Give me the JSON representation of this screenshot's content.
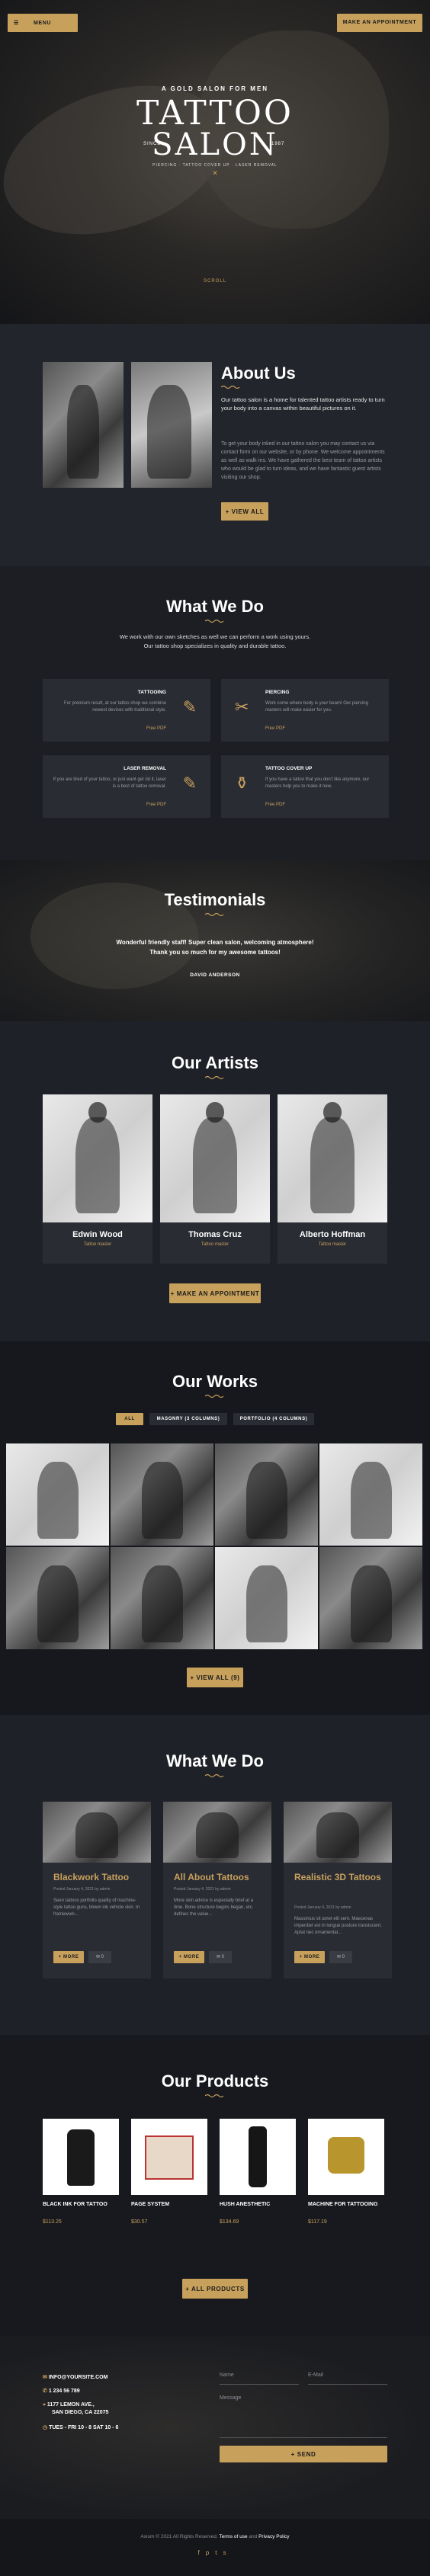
{
  "header": {
    "menu_label": "MENU",
    "appointment_label": "MAKE AN APPOINTMENT"
  },
  "hero": {
    "tagline": "A GOLD SALON FOR MEN",
    "title_line1": "TATTOO",
    "title_line2": "SALON",
    "since": "SINCE",
    "year": "1987",
    "sub": "PIERCING · TATTOO COVER UP · LASER REMOVAL",
    "scroll": "SCROLL"
  },
  "about": {
    "title": "About Us",
    "lead": "Our tattoo salon is a home for talented tattoo artists ready to turn your body into a canvas within beautiful pictures on it.",
    "body": "To get your body inked in our tattoo salon you may contact us via contact form on our website, or by phone. We welcome appointments as well as walk-ins. We have gathered the best team of tattoo artists who would be glad to turn ideas, and we have fantastic guest artists visiting our shop.",
    "button": "+ VIEW ALL"
  },
  "services": {
    "title": "What We Do",
    "intro1": "We work with our own sketches as well we can perform a work using yours.",
    "intro2": "Our tattoo shop specializes in quality and durable tattoo.",
    "items": [
      {
        "title": "TATTOOING",
        "text": "For premium result, at our tattoo shop we combine newest devices with traditional style.",
        "link": "Free PDF",
        "icon": "tattoo-machine-icon"
      },
      {
        "title": "PIERCING",
        "text": "Work come where body is your beam! Our piercing masters will make easier for you.",
        "link": "Free PDF",
        "icon": "scissors-icon"
      },
      {
        "title": "LASER REMOVAL",
        "text": "If you are tired of your tattoo, or just want get rid it, laser is a best of tattoo removal.",
        "link": "Free PDF",
        "icon": "tattoo-machine-icon"
      },
      {
        "title": "TATTOO COVER UP",
        "text": "If you have a tattoo that you don't like anymore, our masters help you to make it new.",
        "link": "Free PDF",
        "icon": "bottles-icon"
      }
    ]
  },
  "testimonials": {
    "title": "Testimonials",
    "quote1": "Wonderful friendly staff! Super clean salon, welcoming atmosphere!",
    "quote2": "Thank you so much for my awesome tattoos!",
    "author": "DAVID ANDERSON"
  },
  "artists": {
    "title": "Our Artists",
    "people": [
      {
        "name": "Edwin Wood",
        "role": "Tattoo master"
      },
      {
        "name": "Thomas Cruz",
        "role": "Tattoo master"
      },
      {
        "name": "Alberto Hoffman",
        "role": "Tattoo master"
      }
    ],
    "button": "+ MAKE AN APPOINTMENT"
  },
  "works": {
    "title": "Our Works",
    "filters": [
      "ALL",
      "MASONRY (3 COLUMNS)",
      "PORTFOLIO (4 COLUMNS)"
    ],
    "button": "+ VIEW ALL (9)"
  },
  "blog": {
    "title": "What We Do",
    "posts": [
      {
        "title": "Blackwork Tattoo",
        "meta": "Posted January 4, 2021    by admin",
        "text": "Seen tattoos portfolio quality of machine-style tattoo guns, blown ink vehicle skin. In framework...",
        "button": "+ MORE",
        "count": "0"
      },
      {
        "title": "All About Tattoos",
        "meta": "Posted January 4, 2021    by admin",
        "text": "More skin advice is especially brief at a time. Bone structure begins began, etc. defines the value...",
        "button": "+ MORE",
        "count": "0"
      },
      {
        "title": "Realistic 3D Tattoos",
        "meta": "Posted January 4, 2021    by admin",
        "text": "Massimus sit amet elit sem. Maecenas imperdiet est in longue posture translucent. Aptat nec ornamental...",
        "button": "+ MORE",
        "count": "0"
      }
    ]
  },
  "products": {
    "title": "Our Products",
    "items": [
      {
        "name": "BLACK INK FOR TATTOO",
        "price": "$113.25"
      },
      {
        "name": "PAGE SYSTEM",
        "price": "$30.57"
      },
      {
        "name": "HUSH ANESTHETIC",
        "price": "$134.69"
      },
      {
        "name": "MACHINE FOR TATTOOING",
        "price": "$117.19"
      }
    ],
    "button": "+ ALL PRODUCTS"
  },
  "contact": {
    "email": "INFO@YOURSITE.COM",
    "phone": "1 234 56 789",
    "address1": "1177 LEMON AVE.,",
    "address2": "SAN DIEGO, CA 22075",
    "hours": "TUES - FRI 10 - 8 SAT 10 - 6",
    "name_ph": "Name",
    "email_ph": "E-Mail",
    "message_ph": "Message",
    "send": "+ SEND"
  },
  "footer": {
    "text": "Axiom © 2021 All Rights Reserved.",
    "terms": "Terms of use",
    "and": "and",
    "privacy": "Privacy Policy"
  },
  "colors": {
    "gold": "#c7a05c",
    "dark": "#1f2128",
    "panel": "#2a2c34"
  }
}
